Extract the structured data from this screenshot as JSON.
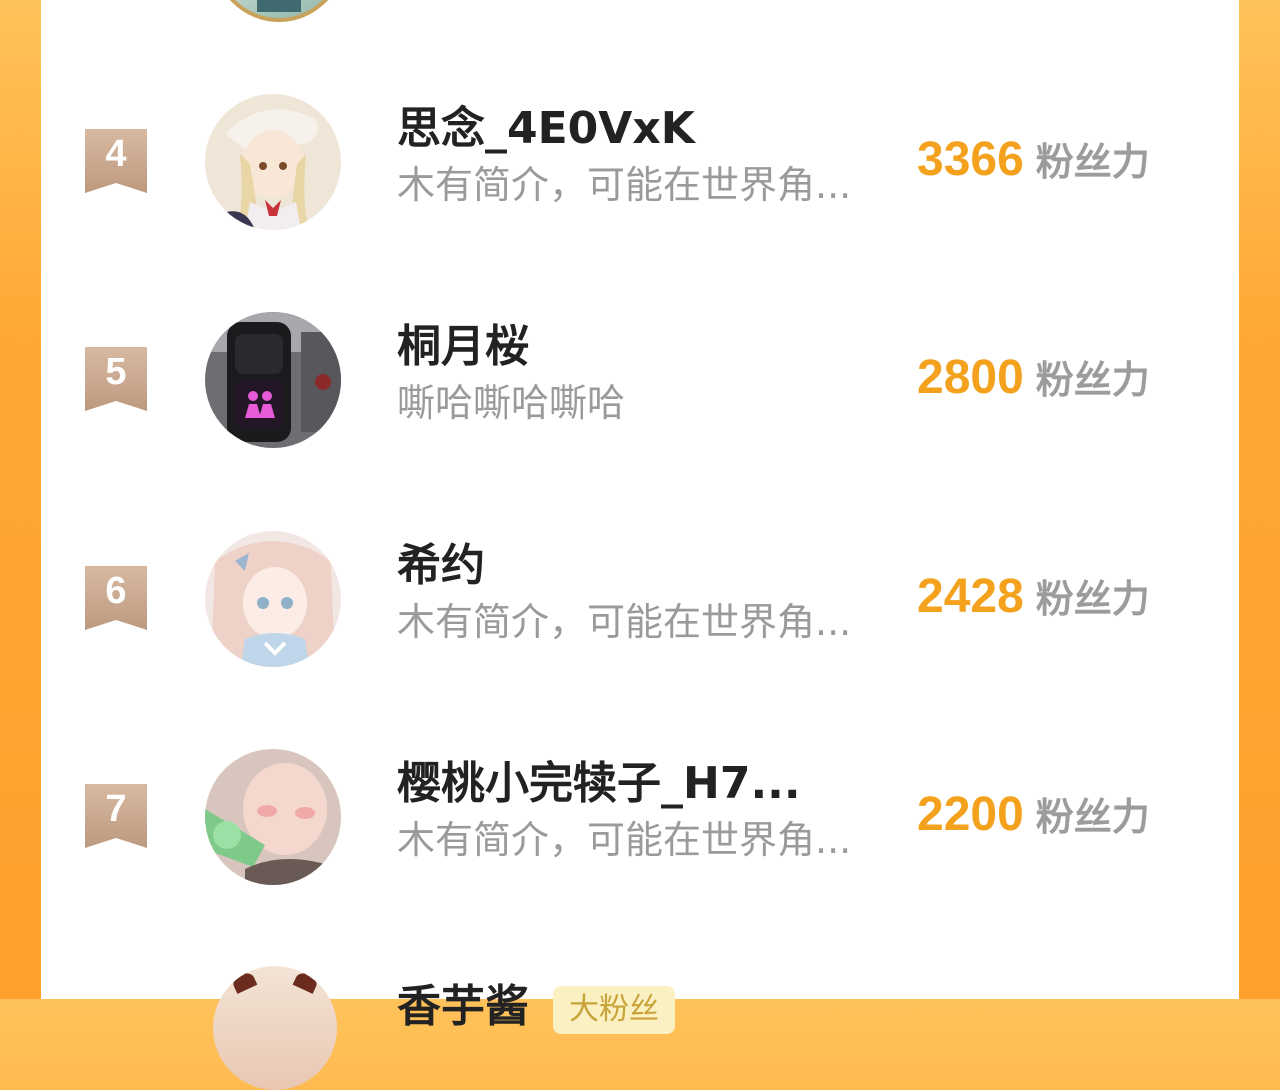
{
  "stat_unit": "粉丝力",
  "colors": {
    "accent_value": "#F4A21D",
    "badge": "#C9A68A",
    "background_orange": "#FFA733"
  },
  "ranking": [
    {
      "rank": "4",
      "name": "思念_4E0VxK",
      "bio": "木有简介，可能在世界角...",
      "fans": "3366"
    },
    {
      "rank": "5",
      "name": "桐月桜",
      "bio": "嘶哈嘶哈嘶哈",
      "fans": "2800"
    },
    {
      "rank": "6",
      "name": "希约",
      "bio": "木有简介，可能在世界角...",
      "fans": "2428"
    },
    {
      "rank": "7",
      "name": "樱桃小完犊子_H7...",
      "bio": "木有简介，可能在世界角...",
      "fans": "2200"
    }
  ],
  "partial_next": {
    "name": "香芋酱",
    "tag": "大粉丝"
  }
}
